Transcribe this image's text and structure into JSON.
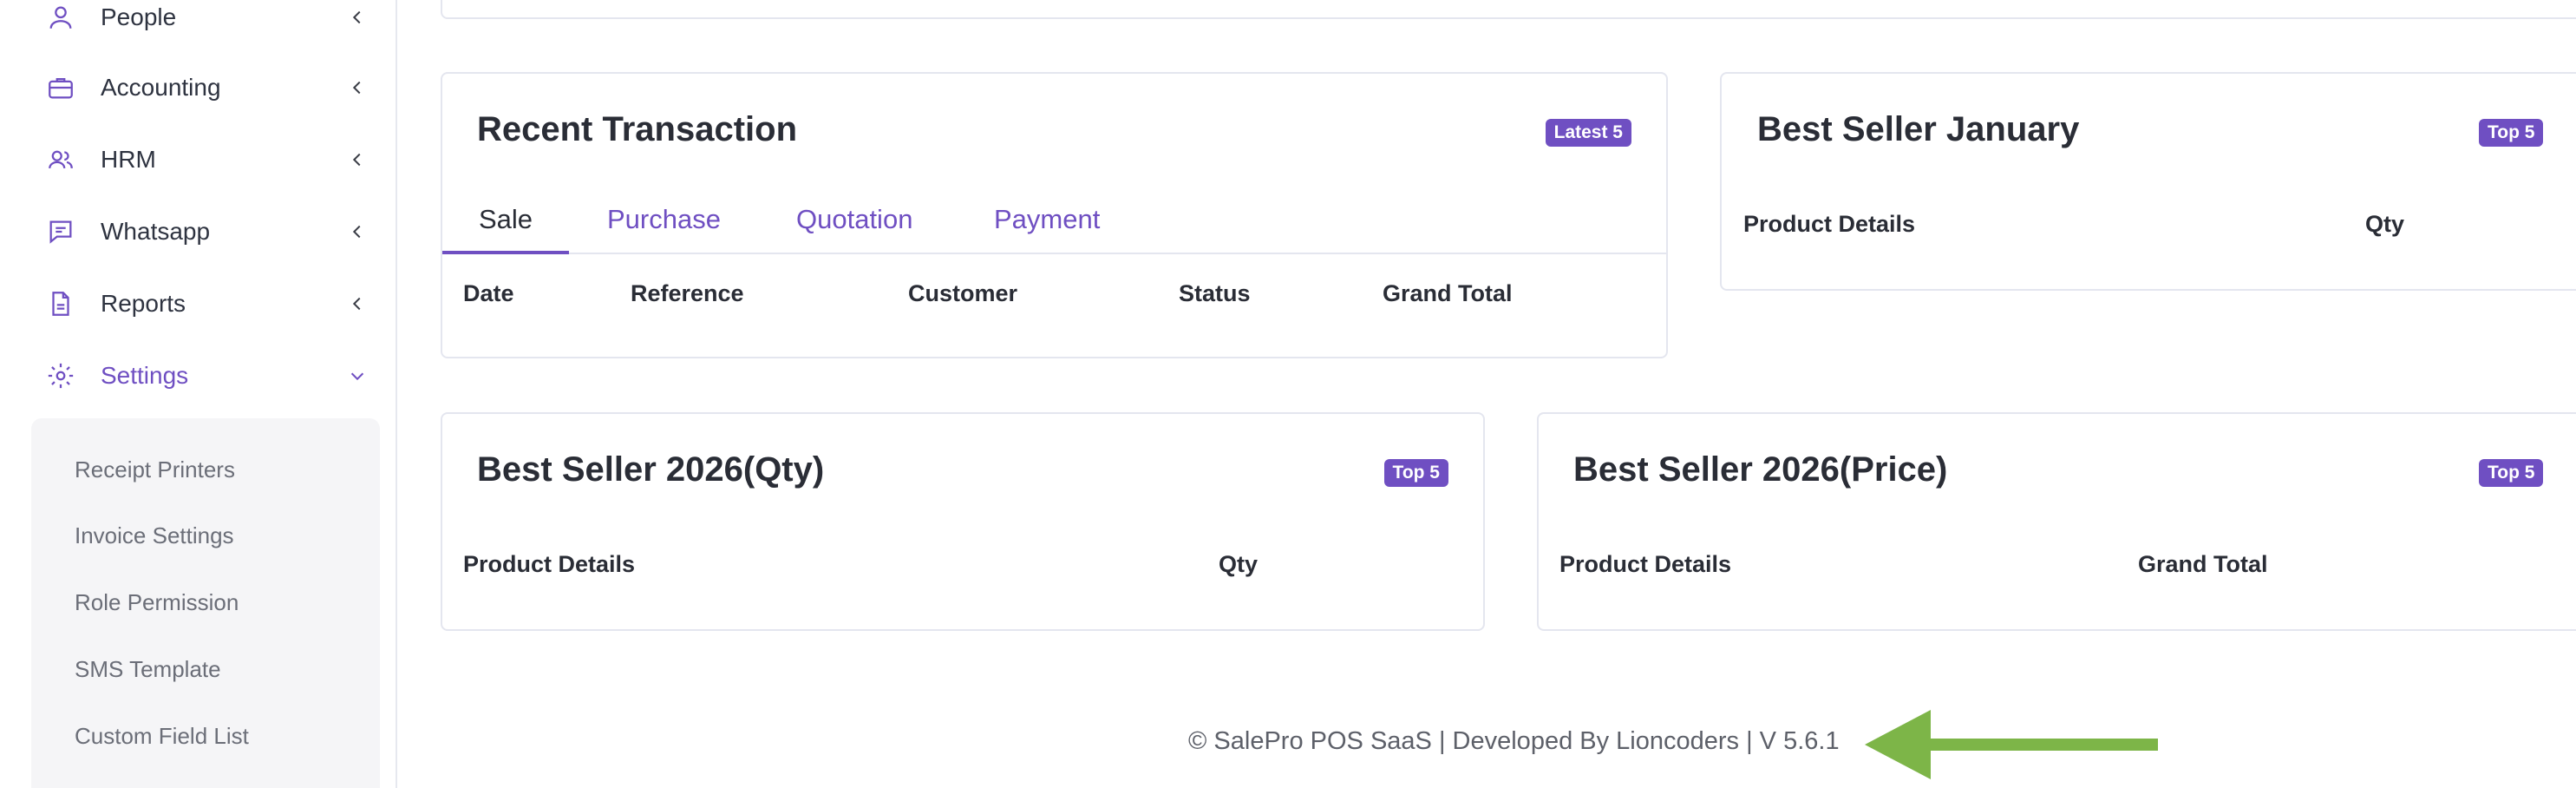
{
  "sidebar": {
    "items": [
      {
        "label": "People",
        "icon": "user-icon"
      },
      {
        "label": "Accounting",
        "icon": "briefcase-icon"
      },
      {
        "label": "HRM",
        "icon": "users-icon"
      },
      {
        "label": "Whatsapp",
        "icon": "chat-icon"
      },
      {
        "label": "Reports",
        "icon": "document-icon"
      },
      {
        "label": "Settings",
        "icon": "gear-icon"
      }
    ],
    "settings_submenu": [
      "Receipt Printers",
      "Invoice Settings",
      "Role Permission",
      "SMS Template",
      "Custom Field List"
    ]
  },
  "recent_transaction": {
    "title": "Recent Transaction",
    "badge": "Latest 5",
    "tabs": [
      "Sale",
      "Purchase",
      "Quotation",
      "Payment"
    ],
    "active_tab": "Sale",
    "columns": [
      "Date",
      "Reference",
      "Customer",
      "Status",
      "Grand Total"
    ]
  },
  "best_seller_month": {
    "title": "Best Seller January",
    "badge": "Top 5",
    "columns": [
      "Product Details",
      "Qty"
    ]
  },
  "best_seller_year_qty": {
    "title": "Best Seller 2026(Qty)",
    "badge": "Top 5",
    "columns": [
      "Product Details",
      "Qty"
    ]
  },
  "best_seller_year_price": {
    "title": "Best Seller 2026(Price)",
    "badge": "Top 5",
    "columns": [
      "Product Details",
      "Grand Total"
    ]
  },
  "footer": {
    "text": "© SalePro POS SaaS | Developed By Lioncoders | V 5.6.1"
  },
  "colors": {
    "accent": "#6f4fc2",
    "annotation_arrow": "#7db548"
  }
}
